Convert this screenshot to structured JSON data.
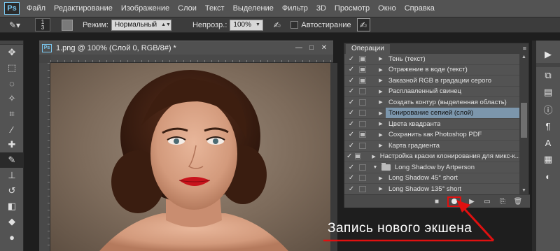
{
  "menu": {
    "logo": "Ps",
    "items": [
      "Файл",
      "Редактирование",
      "Изображение",
      "Слои",
      "Текст",
      "Выделение",
      "Фильтр",
      "3D",
      "Просмотр",
      "Окно",
      "Справка"
    ]
  },
  "options": {
    "brush_size": "1",
    "brush_size_sub": "3",
    "mode_label": "Режим:",
    "mode_value": "Нормальный",
    "opacity_label": "Непрозр.:",
    "opacity_value": "100%",
    "autoerase_label": "Автостирание"
  },
  "document": {
    "icon": "Ps",
    "title": "1.png @ 100% (Слой 0, RGB/8#) *"
  },
  "actions_panel": {
    "tab": "Операции",
    "rows": [
      {
        "check": "✓",
        "dialog": true,
        "expand": "▶",
        "label": "Тень (текст)"
      },
      {
        "check": "✓",
        "dialog": true,
        "expand": "▶",
        "label": "Отражение в воде (текст)"
      },
      {
        "check": "✓",
        "dialog": true,
        "expand": "▶",
        "label": "Заказной RGB в градации серого"
      },
      {
        "check": "✓",
        "dialog": false,
        "expand": "▶",
        "label": "Расплавленный свинец"
      },
      {
        "check": "✓",
        "dialog": false,
        "expand": "▶",
        "label": "Создать контур (выделенная область)"
      },
      {
        "check": "✓",
        "dialog": false,
        "expand": "▶",
        "label": "Тонирование сепией (слой)"
      },
      {
        "check": "✓",
        "dialog": false,
        "expand": "▶",
        "label": "Цвета квадранта"
      },
      {
        "check": "✓",
        "dialog": true,
        "expand": "▶",
        "label": "Сохранить как Photoshop PDF"
      },
      {
        "check": "✓",
        "dialog": false,
        "expand": "▶",
        "label": "Карта градиента"
      },
      {
        "check": "✓",
        "dialog": true,
        "expand": "▶",
        "label": "Настройка краски клонирования для микс-к..."
      },
      {
        "check": "✓",
        "dialog": false,
        "expand": "▼",
        "label": "Long Shadow by Artperson"
      },
      {
        "check": "✓",
        "dialog": false,
        "expand": "▶",
        "label": "Long Shadow 45° short"
      },
      {
        "check": "✓",
        "dialog": false,
        "expand": "▶",
        "label": "Long Shadow 135° short"
      }
    ],
    "selected_index": 5
  },
  "annotation": {
    "text": "Запись нового экшена",
    "color": "#e01010"
  },
  "colors": {
    "selection": "#7c96ac",
    "record_highlight": "#e01010",
    "logo": "#7ac9f2"
  }
}
